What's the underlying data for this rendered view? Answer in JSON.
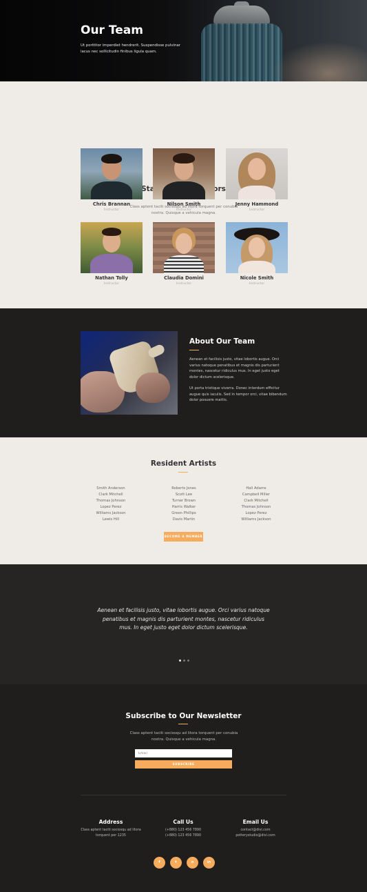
{
  "hero": {
    "title": "Our Team",
    "text": "Ut porttitor imperdiet hendrerit. Suspendisse pulvinar lacus nec sollicitudin finibus ligula quam."
  },
  "staff": {
    "title": "Staff and Instructors",
    "subtitle": "Class aptent taciti sociosqu ad litora torquent per conubia nostra. Quisque a vehicula magna.",
    "members": [
      {
        "name": "Chris Brannan",
        "role": "Instructor"
      },
      {
        "name": "Nilson Smith",
        "role": "Instructor"
      },
      {
        "name": "Jenny Hammond",
        "role": "Instructor"
      },
      {
        "name": "Nathan Tolly",
        "role": "Instructor"
      },
      {
        "name": "Claudia Domini",
        "role": "Instructor"
      },
      {
        "name": "Nicole Smith",
        "role": "Instructor"
      }
    ]
  },
  "about": {
    "title": "About Our Team",
    "p1": "Aenean et facilisis justo, vitae lobortis augue. Orci varius natoque penatibus et magnis dis parturient montes, nascetur ridiculus mus. In eget justo eget dolor dictum scelerisque.",
    "p2": "Ut porta tristique viverra. Donec interdum efficitur augue quis iaculis. Sed in tempor orci, vitae bibendum dolor posuere mattis."
  },
  "artists": {
    "title": "Resident Artists",
    "col1": [
      "Smith Anderson",
      "Clark Mitchell",
      "Thomas Johnson",
      "Lopez Perez",
      "Williams Jackson",
      "Lewis Hill"
    ],
    "col2": [
      "Roberts Jones",
      "Scott Lee",
      "Turner Brown",
      "Harris Walker",
      "Green Phillips",
      "Davis Martin"
    ],
    "col3": [
      "Hall Adams",
      "Campbell Miller",
      "Clark Mitchell",
      "Thomas Johnson",
      "Lopez Perez",
      "Williams Jackson"
    ],
    "button": "BECOME A MEMBER"
  },
  "testimonial": {
    "text": "Aenean et facilisis justo, vitae lobortis augue. Orci varius natoque penatibus et magnis dis parturient montes, nascetur ridiculus mus. In eget justo eget dolor dictum scelerisque."
  },
  "newsletter": {
    "title": "Subscribe to Our Newsletter",
    "subtitle": "Class aptent taciti sociosqu ad litora torquent per conubia nostra. Quisque a vehicula magna.",
    "email_placeholder": "Email",
    "button": "SUBSCRIBE"
  },
  "footer": {
    "address_title": "Address",
    "address_lines": [
      "Class aptent taciti sociosqu ad litora",
      "torquent per 1235"
    ],
    "call_title": "Call Us",
    "call_lines": [
      "(+880) 123 456 7890",
      "(+880) 123 456 7890"
    ],
    "email_title": "Email Us",
    "email_lines": [
      "contact@divi.com",
      "potterystudio@divi.com"
    ],
    "socials": [
      "f",
      "t",
      "o",
      "in"
    ]
  },
  "colors": {
    "accent": "#f6ac5c",
    "light_bg": "#efebe7",
    "dark_bg": "#1f1e1d"
  }
}
